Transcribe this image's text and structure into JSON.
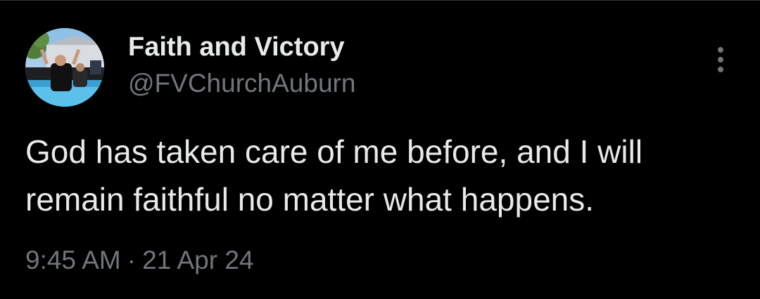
{
  "author": {
    "name": "Faith and Victory",
    "handle": "@FVChurchAuburn",
    "avatar_icon": "baptism-photo-avatar"
  },
  "tweet": {
    "text": "God has taken care of me before, and I will remain faithful no matter what happens.",
    "time": "9:45 AM",
    "separator": "·",
    "date": "21 Apr 24"
  },
  "icons": {
    "more": "more-vertical-icon"
  },
  "colors": {
    "background": "#000000",
    "primary_text": "#e7e9ea",
    "secondary_text": "#71767b",
    "divider": "#2f3336"
  }
}
